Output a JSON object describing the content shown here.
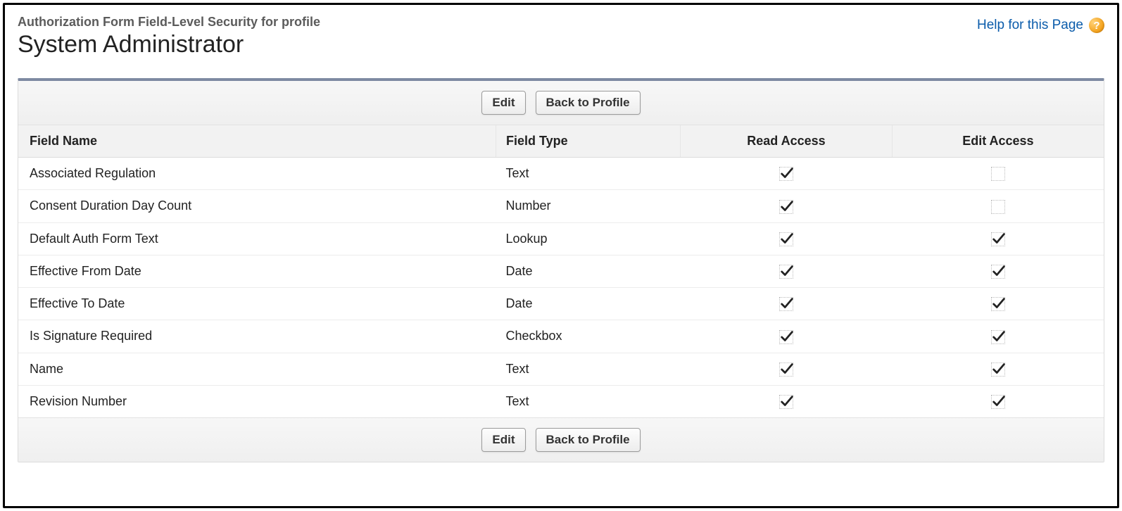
{
  "header": {
    "subtitle": "Authorization Form Field-Level Security for profile",
    "title": "System Administrator",
    "help_label": "Help for this Page"
  },
  "buttons": {
    "edit": "Edit",
    "back": "Back to Profile"
  },
  "table": {
    "columns": {
      "field_name": "Field Name",
      "field_type": "Field Type",
      "read_access": "Read Access",
      "edit_access": "Edit Access"
    },
    "rows": [
      {
        "name": "Associated Regulation",
        "type": "Text",
        "read": true,
        "edit": false
      },
      {
        "name": "Consent Duration Day Count",
        "type": "Number",
        "read": true,
        "edit": false
      },
      {
        "name": "Default Auth Form Text",
        "type": "Lookup",
        "read": true,
        "edit": true
      },
      {
        "name": "Effective From Date",
        "type": "Date",
        "read": true,
        "edit": true
      },
      {
        "name": "Effective To Date",
        "type": "Date",
        "read": true,
        "edit": true
      },
      {
        "name": "Is Signature Required",
        "type": "Checkbox",
        "read": true,
        "edit": true
      },
      {
        "name": "Name",
        "type": "Text",
        "read": true,
        "edit": true
      },
      {
        "name": "Revision Number",
        "type": "Text",
        "read": true,
        "edit": true
      }
    ]
  }
}
